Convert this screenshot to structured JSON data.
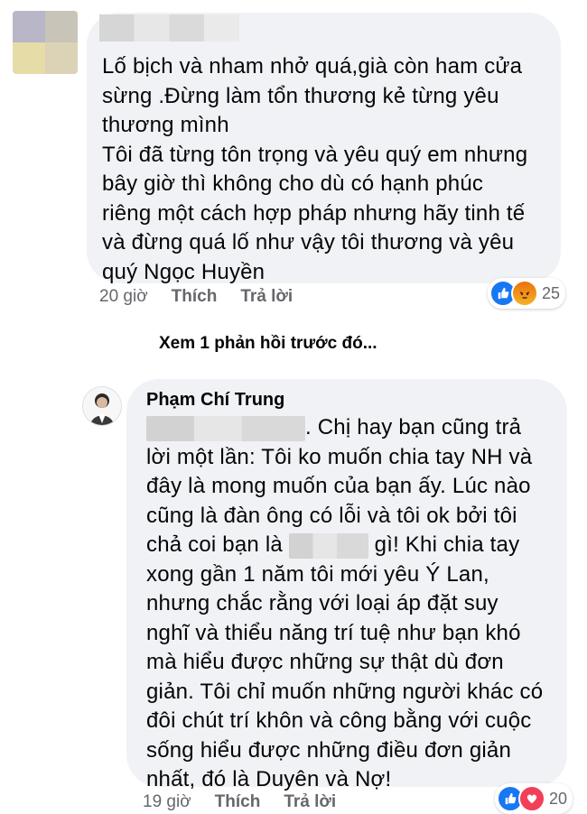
{
  "comment1": {
    "lines": [
      "Lố bịch và nham nhở quá,già còn ham cửa",
      "sừng .Đừng làm tổn thương kẻ từng yêu",
      "thương mình",
      "Tôi đã từng tôn trọng và yêu quý em nhưng",
      "bây giờ thì không cho dù có hạnh phúc",
      "riêng một cách hợp pháp nhưng hãy tinh tế",
      "và đừng quá lố như vậy tôi thương và yêu",
      "quý Ngọc Huyền"
    ],
    "time": "20 giờ",
    "like_label": "Thích",
    "reply_label": "Trả lời",
    "reaction_count": "25"
  },
  "view_previous": "Xem 1 phản hồi trước đó...",
  "comment2": {
    "author": "Phạm Chí Trung",
    "line1_after_blur": ". Chị hay bạn cũng trả",
    "lines_a": [
      "lời một lần: Tôi ko muốn chia tay NH và",
      "đây là mong muốn của bạn ấy. Lúc nào",
      "cũng là đàn ông có lỗi và tôi ok bởi tôi"
    ],
    "line5_before_blur": "chả coi bạn là",
    "line5_after_blur": "gì! Khi chia tay",
    "lines_b": [
      "xong gần 1 năm tôi mới yêu Ý Lan,",
      "nhưng chắc rằng với loại áp đặt suy",
      "nghĩ và thiểu năng trí tuệ như bạn khó",
      "mà hiểu được những sự thật dù đơn",
      "giản. Tôi chỉ muốn những người khác có",
      "đôi chút trí khôn và công bằng với cuộc",
      "sống hiểu được những điều đơn giản",
      "nhất, đó là Duyên và Nợ!"
    ],
    "time": "19 giờ",
    "like_label": "Thích",
    "reply_label": "Trả lời",
    "reaction_count": "20"
  },
  "colors": {
    "bubble": "#f0f2f5",
    "meta": "#65676b",
    "like": "#1877f2",
    "love": "#f33e58"
  },
  "icons": [
    "like-icon",
    "angry-icon",
    "love-icon"
  ]
}
